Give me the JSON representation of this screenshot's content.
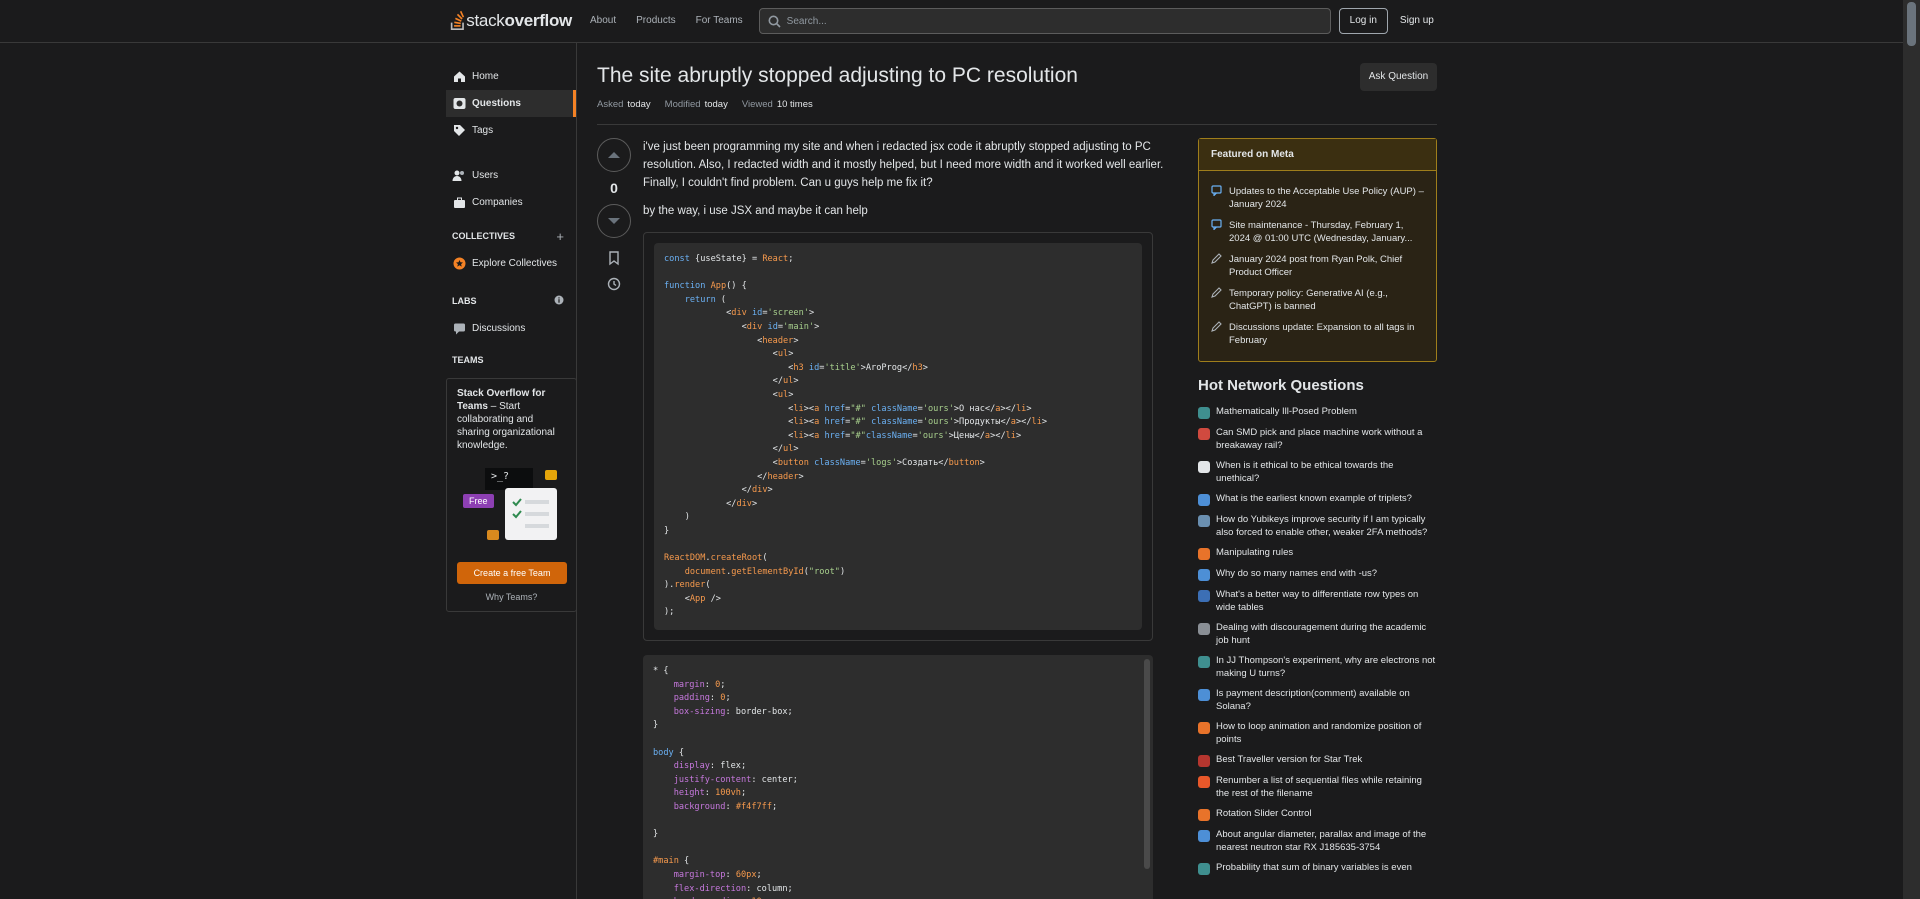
{
  "colors": {
    "accent": "#f48225",
    "featured_border": "#9f7e1b",
    "cta": "#d0650a"
  },
  "topbar": {
    "logo_prefix": "stack",
    "logo_suffix": "overflow",
    "nav": [
      "About",
      "Products",
      "For Teams"
    ],
    "search_placeholder": "Search...",
    "login": "Log in",
    "signup": "Sign up"
  },
  "sidebar": {
    "items": [
      {
        "label": "Home",
        "icon": "home-icon"
      },
      {
        "label": "Questions",
        "icon": "globe-icon"
      },
      {
        "label": "Tags",
        "icon": "tag-icon"
      }
    ],
    "items2": [
      {
        "label": "Users",
        "icon": "users-icon"
      },
      {
        "label": "Companies",
        "icon": "briefcase-icon"
      }
    ],
    "collectives_header": "COLLECTIVES",
    "explore_collectives": "Explore Collectives",
    "labs_header": "LABS",
    "discussions": "Discussions",
    "teams_header": "TEAMS",
    "teams_title": "Stack Overflow for Teams",
    "teams_desc": " – Start collaborating and sharing organizational knowledge.",
    "free_badge": "Free",
    "terminal_text": ">_?",
    "create_team": "Create a free Team",
    "why_teams": "Why Teams?"
  },
  "question": {
    "title": "The site abruptly stopped adjusting to PC resolution",
    "ask_button": "Ask Question",
    "asked_label": "Asked",
    "asked_value": "today",
    "modified_label": "Modified",
    "modified_value": "today",
    "viewed_label": "Viewed",
    "viewed_value": "10 times",
    "votes": "0",
    "body1": "i've just been programming my site and when i redacted jsx code it abruptly stopped adjusting to PC resolution. Also, I redacted width and it mostly helped, but I need more width and it worked well earlier. Finally, I couldn't find problem. Can u guys help me fix it?",
    "body2": "by the way, i use JSX and maybe it can help"
  },
  "featured": {
    "title": "Featured on Meta",
    "items": [
      "Updates to the Acceptable Use Policy (AUP) – January 2024",
      "Site maintenance - Thursday, February 1, 2024 @ 01:00 UTC (Wednesday, January...",
      "January 2024 post from Ryan Polk, Chief Product Officer",
      "Temporary policy: Generative AI (e.g., ChatGPT) is banned",
      "Discussions update: Expansion to all tags in February"
    ]
  },
  "hnq": {
    "title": "Hot Network Questions",
    "items": [
      {
        "label": "Mathematically Ill-Posed Problem",
        "color": "#3f8f8f"
      },
      {
        "label": "Can SMD pick and place machine work without a breakaway rail?",
        "color": "#d04a3f"
      },
      {
        "label": "When is it ethical to be ethical towards the unethical?",
        "color": "#e3e6e8"
      },
      {
        "label": "What is the earliest known example of triplets?",
        "color": "#4d8fd6"
      },
      {
        "label": "How do Yubikeys improve security if I am typically also forced to enable other, weaker 2FA methods?",
        "color": "#6a8fb0"
      },
      {
        "label": "Manipulating rules",
        "color": "#e8732a"
      },
      {
        "label": "Why do so many names end with -us?",
        "color": "#4d8fd6"
      },
      {
        "label": "What's a better way to differentiate row types on wide tables",
        "color": "#3c6fb5"
      },
      {
        "label": "Dealing with discouragement during the academic job hunt",
        "color": "#8a8f95"
      },
      {
        "label": "In JJ Thompson's experiment, why are electrons not making U turns?",
        "color": "#3f8f8f"
      },
      {
        "label": "Is payment description(comment) available on Solana?",
        "color": "#4d8fd6"
      },
      {
        "label": "How to loop animation and randomize position of points",
        "color": "#e8732a"
      },
      {
        "label": "Best Traveller version for Star Trek",
        "color": "#b5362f"
      },
      {
        "label": "Renumber a list of sequential files while retaining the rest of the filename",
        "color": "#e8582a"
      },
      {
        "label": "Rotation Slider Control",
        "color": "#e8732a"
      },
      {
        "label": "About angular diameter, parallax and image of the nearest neutron star RX J185635-3754",
        "color": "#4d8fd6"
      },
      {
        "label": "Probability that sum of binary variables is even",
        "color": "#3f8f8f"
      }
    ]
  }
}
